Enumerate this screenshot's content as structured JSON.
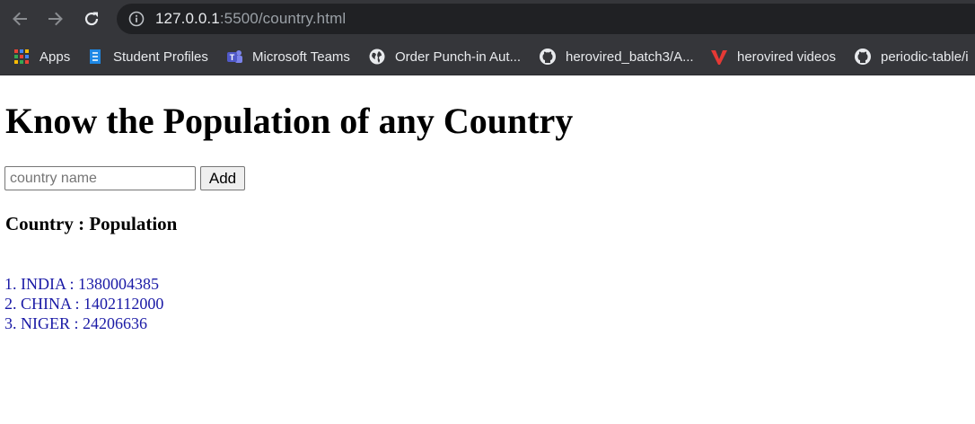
{
  "browser": {
    "url_host": "127.0.0.1",
    "url_rest": ":5500/country.html",
    "bookmarks": [
      {
        "label": "Apps",
        "icon": "apps-grid-icon"
      },
      {
        "label": "Student Profiles",
        "icon": "student-profiles-icon"
      },
      {
        "label": "Microsoft Teams",
        "icon": "teams-icon"
      },
      {
        "label": "Order Punch-in Aut...",
        "icon": "globe-icon"
      },
      {
        "label": "herovired_batch3/A...",
        "icon": "github-icon"
      },
      {
        "label": "herovired videos",
        "icon": "herovired-icon"
      },
      {
        "label": "periodic-table/i",
        "icon": "github-icon"
      }
    ]
  },
  "page": {
    "heading": "Know the Population of any Country",
    "input_placeholder": "country name",
    "input_value": "",
    "add_button": "Add",
    "subheading": "Country : Population",
    "results": [
      "1. INDIA : 1380004385",
      "2. CHINA : 1402112000",
      "3. NIGER : 24206636"
    ]
  }
}
